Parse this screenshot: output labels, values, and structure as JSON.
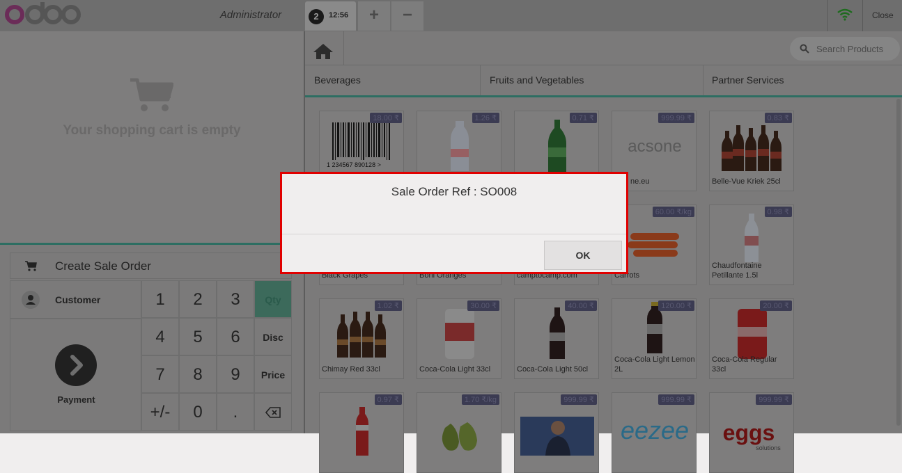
{
  "topbar": {
    "user": "Administrator",
    "order_number": "2",
    "order_time": "12:56",
    "add_label": "+",
    "remove_label": "−",
    "close_label": "Close"
  },
  "cart": {
    "empty_text": "Your shopping cart is empty",
    "create_sale_order_label": "Create Sale Order",
    "customer_label": "Customer",
    "payment_label": "Payment"
  },
  "numpad": {
    "keys": [
      "1",
      "2",
      "3",
      "4",
      "5",
      "6",
      "7",
      "8",
      "9",
      "+/-",
      "0",
      "."
    ],
    "qty": "Qty",
    "disc": "Disc",
    "price": "Price"
  },
  "search": {
    "placeholder": "Search Products"
  },
  "categories": [
    "Beverages",
    "Fruits and Vegetables",
    "Partner Services"
  ],
  "products": [
    {
      "name": "",
      "price": "18.00 ₹"
    },
    {
      "name": "",
      "price": "1.26 ₹"
    },
    {
      "name": "",
      "price": "0.71 ₹"
    },
    {
      "name": "ne.eu",
      "price": "999.99 ₹"
    },
    {
      "name": "Belle-Vue Kriek 25cl",
      "price": "0.83 ₹"
    },
    {
      "name": "Black Grapes",
      "price": ""
    },
    {
      "name": "Boni Oranges",
      "price": ""
    },
    {
      "name": "camptocamp.com",
      "price": ""
    },
    {
      "name": "Carrots",
      "price": "60.00 ₹/kg"
    },
    {
      "name": "Chaudfontaine Petillante 1.5l",
      "price": "0.98 ₹"
    },
    {
      "name": "Chimay Red 33cl",
      "price": "1.02 ₹"
    },
    {
      "name": "Coca-Cola Light 33cl",
      "price": "30.00 ₹"
    },
    {
      "name": "Coca-Cola Light 50cl",
      "price": "40.00 ₹"
    },
    {
      "name": "Coca-Cola Light Lemon 2L",
      "price": "120.00 ₹"
    },
    {
      "name": "Coca-Cola Regular 33cl",
      "price": "20.00 ₹"
    },
    {
      "name": "",
      "price": "0.97 ₹"
    },
    {
      "name": "",
      "price": "1.70 ₹/kg"
    },
    {
      "name": "",
      "price": "999.99 ₹"
    },
    {
      "name": "",
      "price": "999.99 ₹"
    },
    {
      "name": "",
      "price": "999.99 ₹"
    }
  ],
  "barcode_text": "1 234567 890128 >",
  "acsone_text": "acsone",
  "eezee_text": "eezee",
  "eggs_text": "eggs",
  "eggs_sub": "solutions",
  "dialog": {
    "title": "Sale Order Ref : SO008",
    "ok_label": "OK"
  },
  "colors": {
    "accent": "#2d6e62",
    "dialog_border": "#e00000",
    "price_badge": "#3b3b52"
  }
}
